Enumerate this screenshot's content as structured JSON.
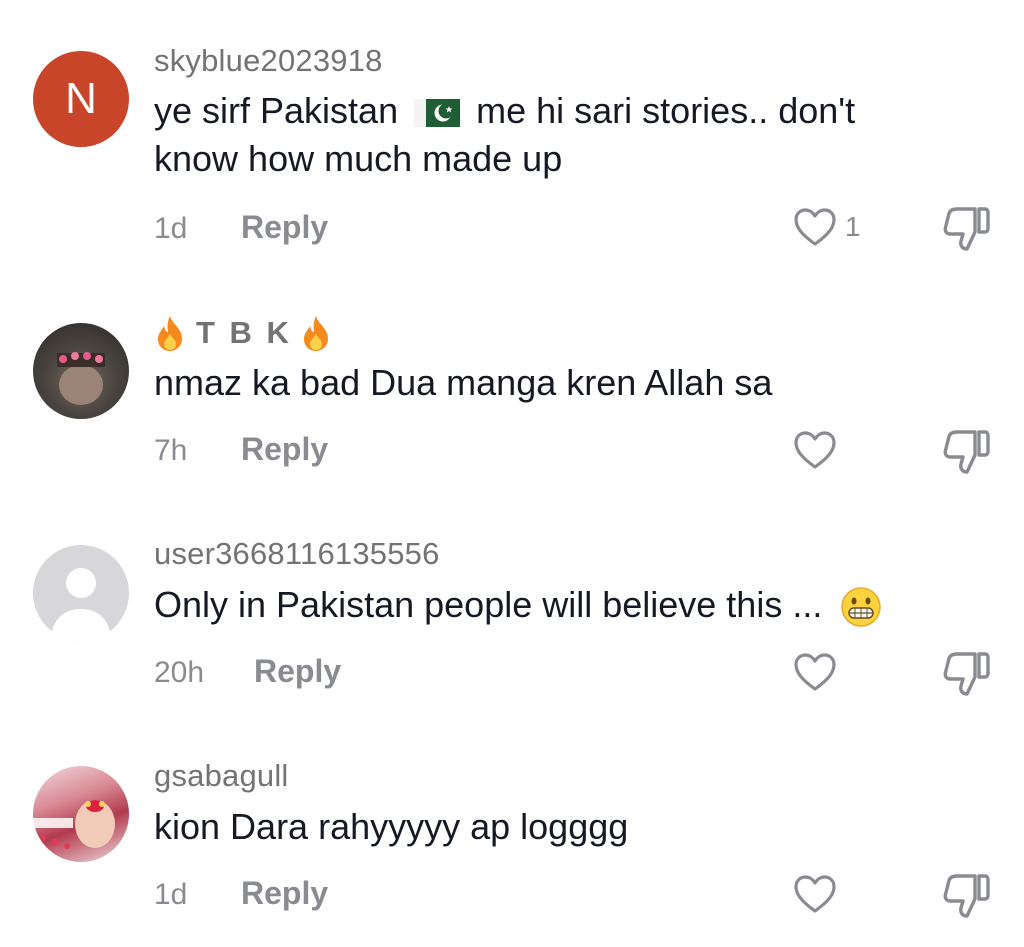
{
  "comments": [
    {
      "username": "skyblue2023918",
      "avatar_letter": "N",
      "text_before": "ye sirf Pakistan",
      "flag": "pakistan-flag",
      "text_after": "me hi sari stories.. don't",
      "text_line2": "know how much made up",
      "time": "1d",
      "reply_label": "Reply",
      "like_count": "1"
    },
    {
      "username": "T B K",
      "username_decoration": "fire-emoji",
      "text": "nmaz ka bad Dua manga kren Allah sa",
      "time": "7h",
      "reply_label": "Reply"
    },
    {
      "username": "user3668116135556",
      "text": "Only in Pakistan people will believe this ...",
      "emoji": "grinning-face-emoji",
      "time": "20h",
      "reply_label": "Reply"
    },
    {
      "username": "gsabagull",
      "text": "kion Dara rahyyyyy ap logggg",
      "time": "1d",
      "reply_label": "Reply"
    }
  ],
  "colors": {
    "text": "#161823",
    "secondary": "#8a8b91",
    "username": "#737373",
    "avatar_letter_bg": "#c8452a"
  }
}
